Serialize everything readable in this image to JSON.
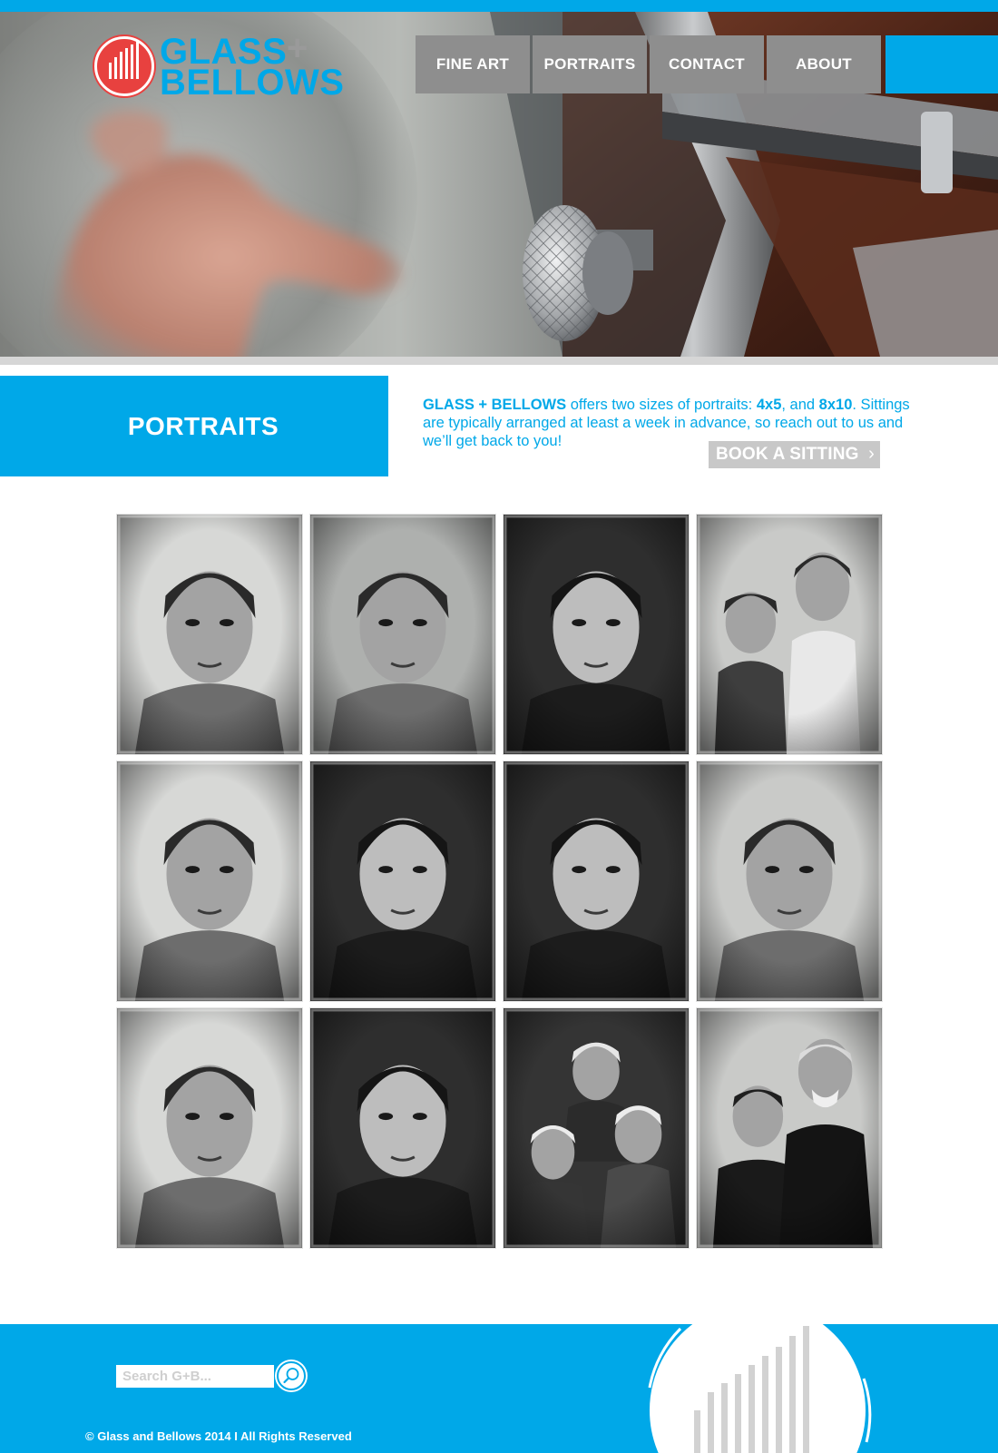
{
  "brand": {
    "logo_line1": "GLASS",
    "logo_plus": "+",
    "logo_line2": "BELLOWS",
    "colors": {
      "accent": "#00a8e8",
      "logo_red": "#e8413f",
      "nav_gray": "#8e8e8e"
    }
  },
  "nav": {
    "items": [
      {
        "label": "FINE ART"
      },
      {
        "label": "PORTRAITS"
      },
      {
        "label": "CONTACT"
      },
      {
        "label": "ABOUT"
      }
    ]
  },
  "section": {
    "title": "PORTRAITS",
    "intro_brand": "GLASS + BELLOWS",
    "intro_part1": " offers two sizes of portraits: ",
    "size1": "4x5",
    "intro_part2": ", and ",
    "size2": "8x10",
    "intro_part3": ".  Sittings are typically arranged at least a week in advance, so reach out to us and we’ll get back to you!",
    "book_label": "BOOK A SITTING",
    "book_icon": "chevron-right-icon"
  },
  "gallery": {
    "portraits": [
      {
        "subject": "woman-short-hair"
      },
      {
        "subject": "woman-blonde-bangs"
      },
      {
        "subject": "man-glasses"
      },
      {
        "subject": "two-children"
      },
      {
        "subject": "man-shaved-head-goatee"
      },
      {
        "subject": "older-woman-polka-dot"
      },
      {
        "subject": "bearded-man"
      },
      {
        "subject": "freckled-child"
      },
      {
        "subject": "young-man-earring"
      },
      {
        "subject": "bald-man-beard"
      },
      {
        "subject": "three-boys"
      },
      {
        "subject": "couple"
      }
    ]
  },
  "footer": {
    "search_placeholder": "Search G+B...",
    "search_icon": "search-icon",
    "copyright": "© Glass and Bellows 2014  I  All Rights Reserved"
  }
}
